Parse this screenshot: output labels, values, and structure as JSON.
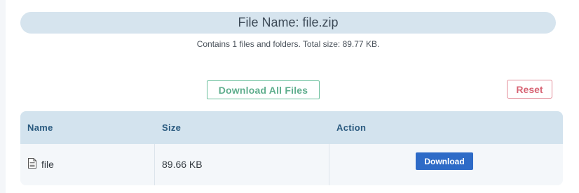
{
  "archive": {
    "title": "File Name: file.zip",
    "summary": "Contains 1 files and folders. Total size: 89.77 KB."
  },
  "actions": {
    "download_all_label": "Download All Files",
    "reset_label": "Reset"
  },
  "table": {
    "columns": [
      "Name",
      "Size",
      "Action"
    ],
    "rows": [
      {
        "name": "file",
        "size": "89.66 KB",
        "action_label": "Download",
        "icon": "file-icon"
      }
    ]
  },
  "colors": {
    "title_bar": "#d6e4ee",
    "download_all": "#5fae8d",
    "reset": "#d76474",
    "download_button": "#2e6bc7",
    "table_header": "#d3e3ee"
  }
}
